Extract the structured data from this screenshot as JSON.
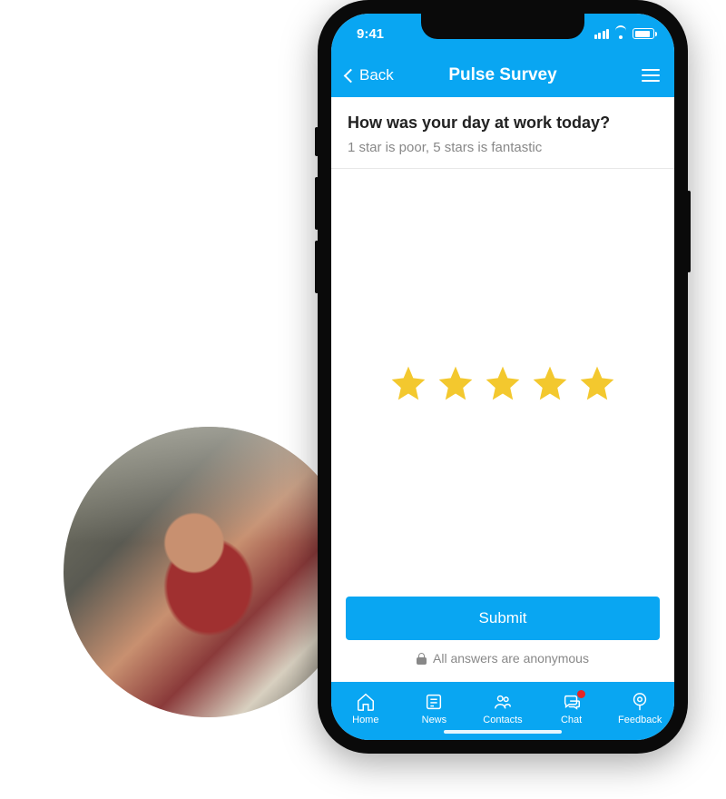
{
  "statusbar": {
    "time": "9:41"
  },
  "navbar": {
    "back_label": "Back",
    "title": "Pulse Survey"
  },
  "survey": {
    "question": "How was your day at work today?",
    "subtitle": "1 star is poor, 5 stars is fantastic",
    "star_count": 5,
    "selected_stars": 5
  },
  "actions": {
    "submit_label": "Submit",
    "anonymous_note": "All answers are anonymous"
  },
  "tabs": [
    {
      "label": "Home"
    },
    {
      "label": "News"
    },
    {
      "label": "Contacts"
    },
    {
      "label": "Chat",
      "badge": true
    },
    {
      "label": "Feedback"
    }
  ],
  "colors": {
    "accent": "#09a6f2",
    "star": "#f3c82e",
    "badge": "#e52525"
  }
}
